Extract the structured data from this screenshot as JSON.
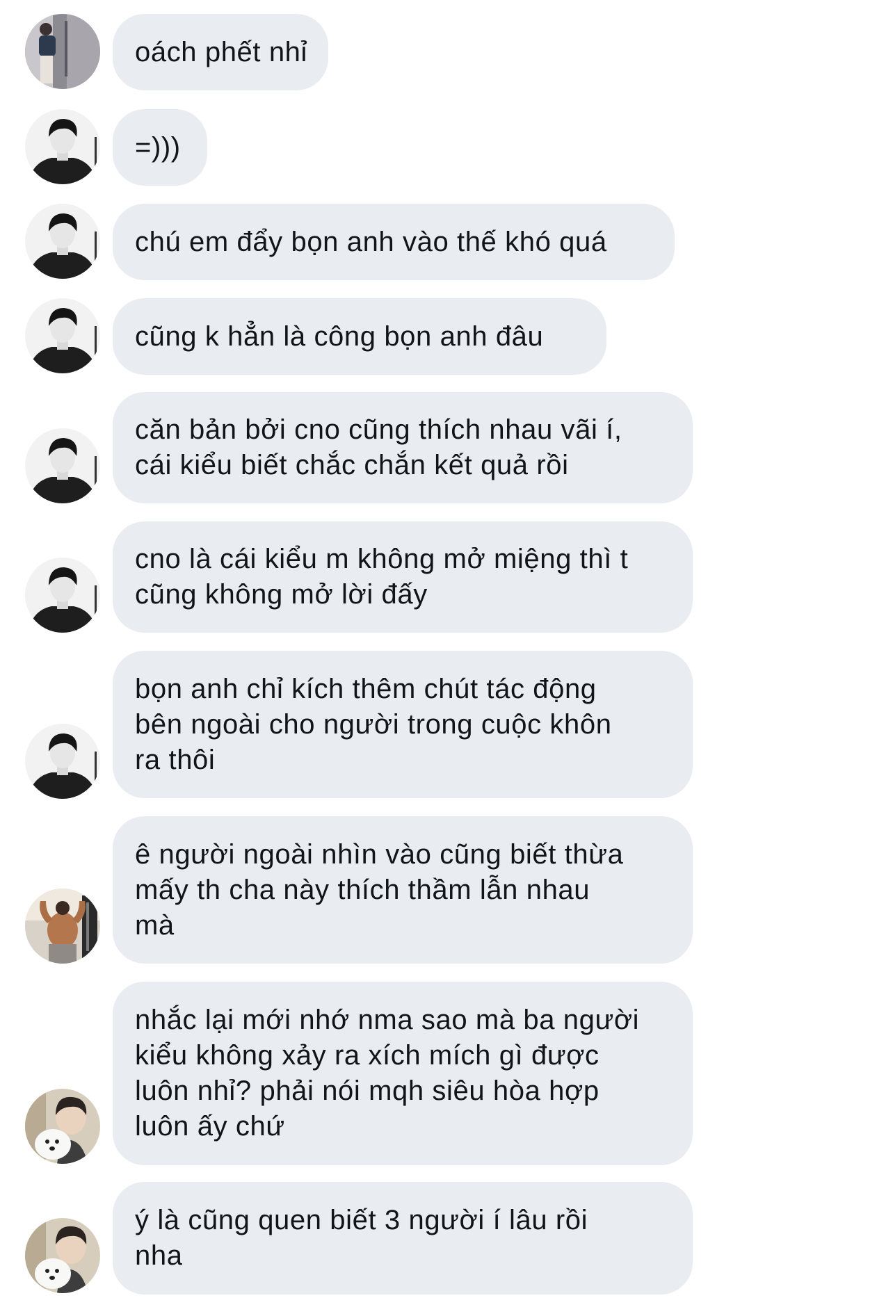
{
  "messages": [
    {
      "avatar_icon": "avatar-man-door-icon",
      "text": "oách phết nhỉ"
    },
    {
      "avatar_icon": "avatar-boy-portrait-icon",
      "text": "=)))"
    },
    {
      "avatar_icon": "avatar-boy-portrait-icon",
      "text": "chú em đẩy bọn anh vào thế khó quá"
    },
    {
      "avatar_icon": "avatar-boy-portrait-icon",
      "text": "cũng k hẳn là công bọn anh đâu"
    },
    {
      "avatar_icon": "avatar-boy-portrait-icon",
      "text": "căn bản bởi cno cũng thích nhau vãi í,\ncái kiểu biết chắc chắn kết quả rồi"
    },
    {
      "avatar_icon": "avatar-boy-portrait-icon",
      "text": "cno là cái kiểu m không mở miệng thì t\ncũng không mở lời đấy"
    },
    {
      "avatar_icon": "avatar-boy-portrait-icon",
      "text": "bọn anh chỉ kích thêm chút tác động\nbên ngoài cho người trong cuộc khôn\nra thôi"
    },
    {
      "avatar_icon": "avatar-gym-man-icon",
      "text": "ê người ngoài nhìn vào cũng biết thừa\nmấy th cha này thích thầm lẫn nhau\nmà"
    },
    {
      "avatar_icon": "avatar-boy-with-dog-icon",
      "text": "nhắc lại mới nhớ nma sao mà ba người\nkiểu không xảy ra xích mích gì được\nluôn nhỉ? phải nói  mqh siêu hòa hợp\nluôn ấy chứ"
    },
    {
      "avatar_icon": "avatar-boy-with-dog-icon",
      "text": "ý là cũng quen biết 3 người í lâu rồi\nnha"
    }
  ]
}
